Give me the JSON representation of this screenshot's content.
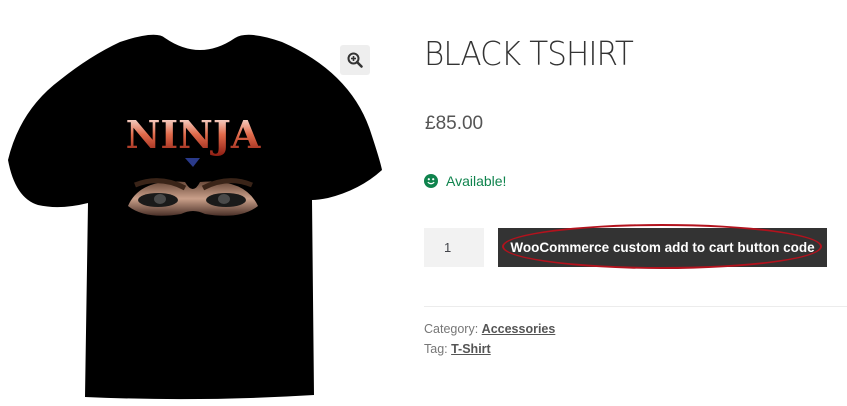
{
  "product": {
    "image_label": "NINJA",
    "title": "BLACK TSHIRT",
    "price": "£85.00",
    "stock_status": "Available!",
    "quantity": "1",
    "add_to_cart_label": "WooCommerce custom add to cart button code",
    "category_prefix": "Category: ",
    "category": "Accessories",
    "tag_prefix": "Tag: ",
    "tag": "T-Shirt"
  },
  "colors": {
    "stock_green": "#0f834d",
    "button_bg": "#333333",
    "highlight_red": "#b3121d"
  },
  "icons": {
    "zoom": "magnifier-plus-icon",
    "stock": "smiley-icon"
  }
}
